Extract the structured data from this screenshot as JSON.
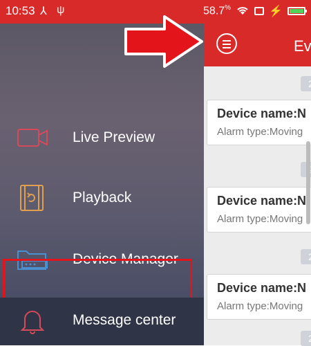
{
  "status_bar": {
    "time": "10:53",
    "icons": [
      "usb-tether-icon",
      "usb-icon"
    ],
    "battery_text": "58.7",
    "battery_unit": "%"
  },
  "drawer": {
    "items": [
      {
        "label": "Live Preview",
        "icon": "camera-icon"
      },
      {
        "label": "Playback",
        "icon": "film-icon"
      },
      {
        "label": "Device Manager",
        "icon": "folder-dvr-icon",
        "highlighted": true
      },
      {
        "label": "Message center",
        "icon": "bell-icon"
      }
    ]
  },
  "panel": {
    "title": "Ev",
    "date_chip": "2",
    "cards": [
      {
        "name": "Device name:N",
        "alarm": "Alarm type:Moving"
      },
      {
        "name": "Device name:N",
        "alarm": "Alarm type:Moving"
      },
      {
        "name": "Device name:N",
        "alarm": "Alarm type:Moving"
      }
    ]
  },
  "colors": {
    "accent_red": "#d92a2a",
    "highlight_red": "#e4141b"
  }
}
